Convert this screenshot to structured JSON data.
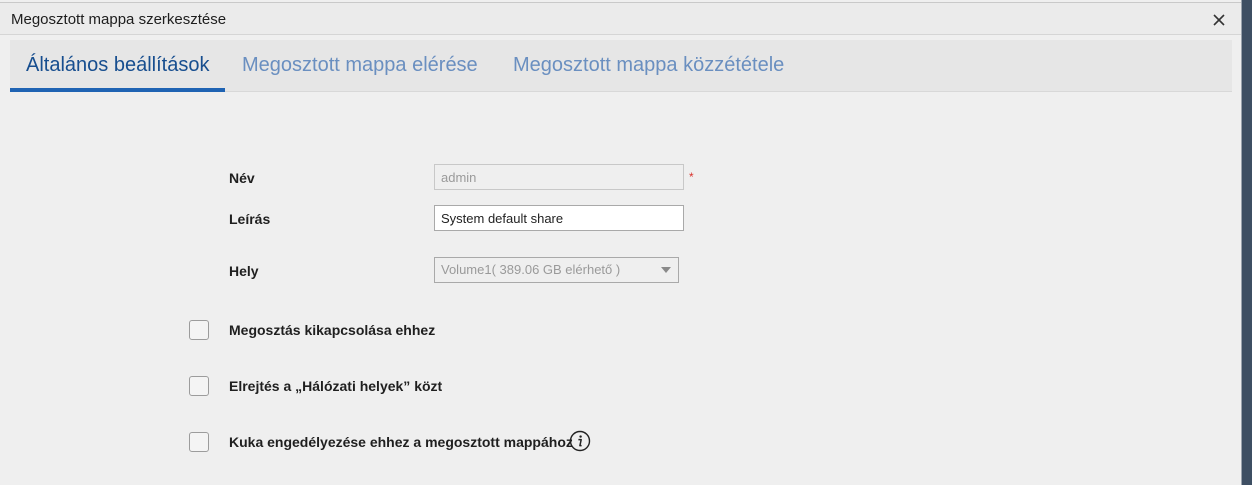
{
  "dialog": {
    "title": "Megosztott mappa szerkesztése",
    "close_icon": "close-icon"
  },
  "tabs": [
    {
      "label": "Általános beállítások",
      "active": true
    },
    {
      "label": "Megosztott mappa elérése",
      "active": false
    },
    {
      "label": "Megosztott mappa közzététele",
      "active": false
    }
  ],
  "colors": {
    "accent": "#1f63b3",
    "active_tab_text": "#174e8f",
    "inactive_tab_text": "#6a8fc0",
    "required_mark": "#d9322d"
  },
  "form": {
    "name": {
      "label": "Név",
      "value": "admin",
      "required_mark": "*",
      "disabled": true
    },
    "description": {
      "label": "Leírás",
      "value": "System default share"
    },
    "location": {
      "label": "Hely",
      "selected": "Volume1( 389.06 GB elérhető )",
      "disabled": true
    },
    "options": [
      {
        "label": "Megosztás kikapcsolása ehhez",
        "checked": false
      },
      {
        "label": "Elrejtés a „Hálózati helyek” közt",
        "checked": false
      },
      {
        "label": "Kuka engedélyezése ehhez a megosztott mappához",
        "checked": false,
        "icon": "info-icon"
      }
    ]
  }
}
